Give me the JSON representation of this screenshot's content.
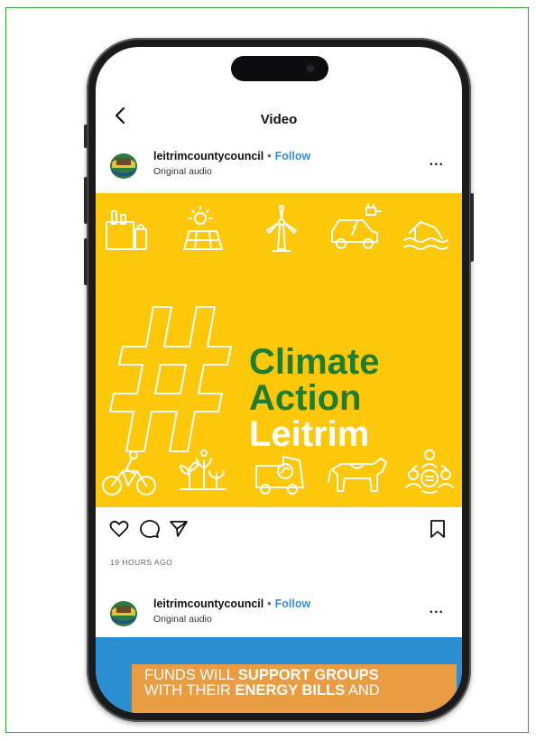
{
  "nav": {
    "title": "Video"
  },
  "post1": {
    "username": "leitrimcountycouncil",
    "follow": "Follow",
    "subtitle": "Original audio",
    "more": "..."
  },
  "video": {
    "hashtag": "#",
    "line1": "Climate",
    "line2": "Action",
    "line3": "Leitrim",
    "colors": {
      "background": "#fdc70a",
      "green": "#1e7d2f",
      "white": "#ffffff"
    },
    "top_icons": [
      "factory-icon",
      "solar-panel-icon",
      "wind-turbine-icon",
      "electric-car-icon",
      "flood-house-icon"
    ],
    "bottom_icons": [
      "cyclist-icon",
      "plants-icon",
      "food-van-icon",
      "cow-icon",
      "community-icon"
    ]
  },
  "actions": {
    "icons": [
      "heart-icon",
      "comment-icon",
      "share-icon",
      "bookmark-icon"
    ]
  },
  "post1_time": "19 HOURS AGO",
  "post2": {
    "username": "leitrimcountycouncil",
    "follow": "Follow",
    "subtitle": "Original audio",
    "more": "..."
  },
  "banner": {
    "l1a": "FUNDS WILL ",
    "l1b": "SUPPORT GROUPS",
    "l2a": "WITH THEIR ",
    "l2b": "ENERGY BILLS",
    "l2c": " AND",
    "colors": {
      "background": "#2a8ed2",
      "box": "#e99c42"
    }
  }
}
